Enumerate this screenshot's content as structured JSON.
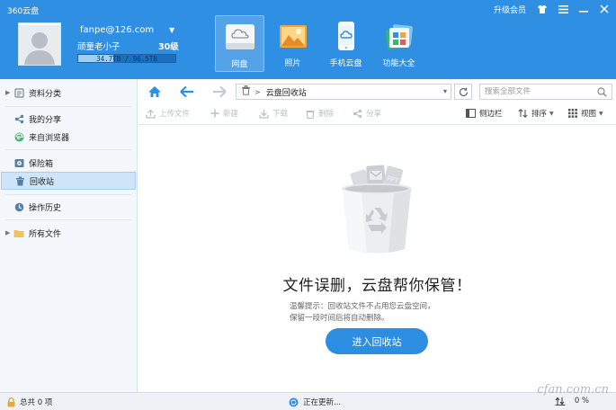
{
  "app": {
    "title": "360云盘"
  },
  "window": {
    "upgrade_label": "升级会员"
  },
  "user": {
    "email": "fanpe@126.com",
    "nickname": "顽童老小子",
    "level": "30级",
    "quota_text": "34.7TB / 96.5TB",
    "quota_used_fraction": 0.36
  },
  "nav": [
    {
      "label": "网盘",
      "icon": "cloud-disk-icon",
      "active": true
    },
    {
      "label": "照片",
      "icon": "photos-icon"
    },
    {
      "label": "手机云盘",
      "icon": "phone-cloud-icon"
    },
    {
      "label": "功能大全",
      "icon": "apps-icon"
    }
  ],
  "sidebar": {
    "items": [
      {
        "label": "资料分类",
        "icon": "category-icon"
      },
      {
        "label": "我的分享",
        "icon": "share-icon"
      },
      {
        "label": "来自浏览器",
        "icon": "browser-icon"
      },
      {
        "label": "保险箱",
        "icon": "safe-icon"
      },
      {
        "label": "回收站",
        "icon": "recycle-bin-icon",
        "active": true
      },
      {
        "label": "操作历史",
        "icon": "history-icon"
      },
      {
        "label": "所有文件",
        "icon": "all-files-icon"
      }
    ]
  },
  "toolbar": {
    "path": "云盘回收站",
    "search_placeholder": "搜索全部文件",
    "actions": {
      "upload": "上传文件",
      "new": "新建",
      "download": "下载",
      "delete": "删除",
      "share": "分享"
    },
    "view": {
      "sidebar": "侧边栏",
      "sort": "排序",
      "view": "视图"
    }
  },
  "main": {
    "title": "文件误删，云盘帮你保管！",
    "tip_line1": "温馨提示：回收站文件不占用您云盘空间，",
    "tip_line2": "保留一段时间后将自动删除。",
    "enter_button": "进入回收站"
  },
  "status": {
    "total": "总共 0 项",
    "updating": "正在更新...",
    "percent": "0 %"
  },
  "watermark": "cfan.com.cn",
  "colors": {
    "header": "#2f8fe3",
    "accent": "#2d8de0",
    "selected": "#cfe5f9"
  }
}
